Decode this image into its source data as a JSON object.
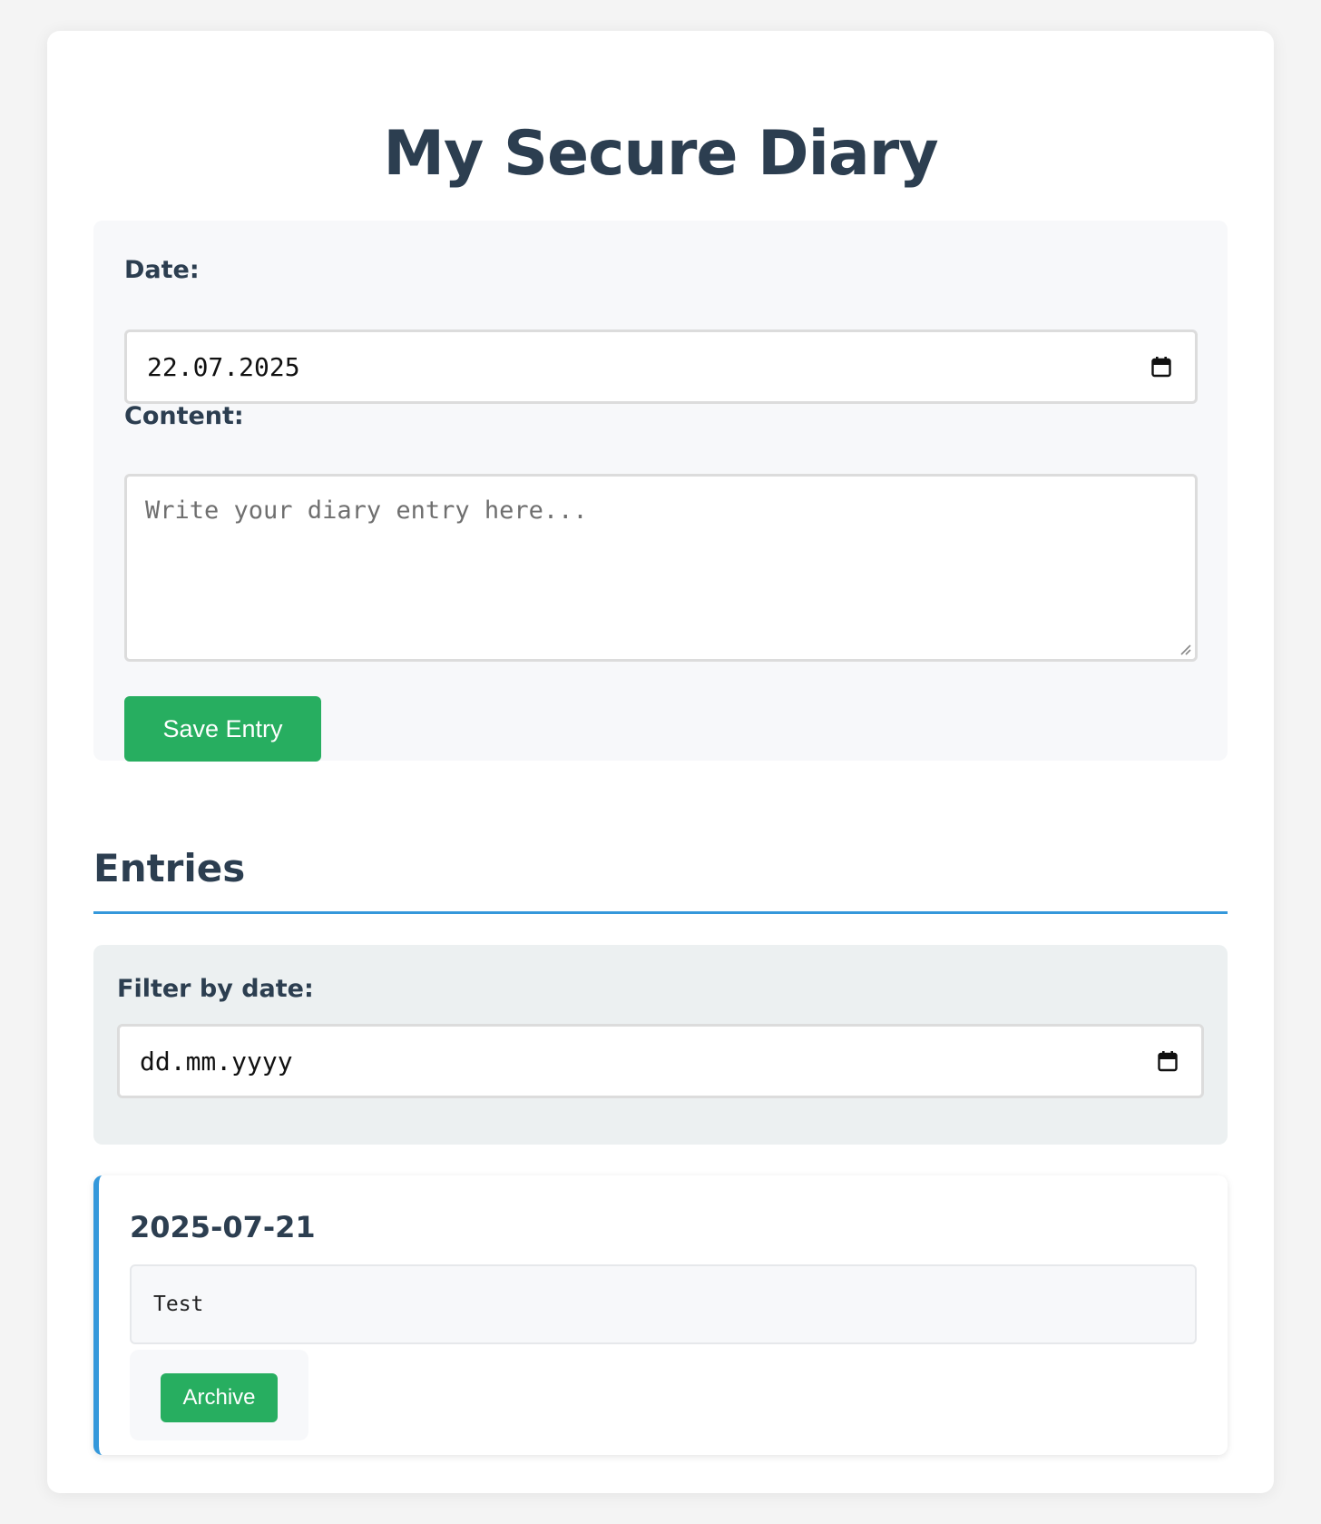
{
  "app": {
    "title": "My Secure Diary"
  },
  "form": {
    "date_label": "Date:",
    "date_value": "22.07.2025",
    "content_label": "Content:",
    "content_placeholder": "Write your diary entry here...",
    "save_label": "Save Entry"
  },
  "entries": {
    "heading": "Entries",
    "filter_label": "Filter by date:",
    "filter_placeholder": "dd.mm.yyyy",
    "items": [
      {
        "date": "2025-07-21",
        "content": "Test",
        "archive_label": "Archive"
      }
    ]
  },
  "icons": {
    "date_picker": "calendar-icon",
    "filter_picker": "calendar-icon",
    "textarea_resize": "resize-handle-icon"
  },
  "colors": {
    "accent_blue": "#3498db",
    "button_green": "#27ae60",
    "heading_text": "#2c3e50",
    "page_background": "#f4f4f4"
  }
}
